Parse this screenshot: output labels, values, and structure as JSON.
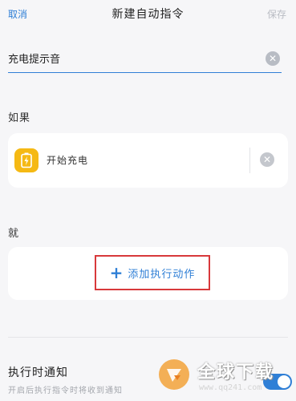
{
  "header": {
    "cancel_label": "取消",
    "title": "新建自动指令",
    "save_label": "保存"
  },
  "command_name": {
    "value": "充电提示音"
  },
  "effect_section": {
    "label": "如果",
    "item_text": "开始充电"
  },
  "action_section": {
    "label": "就",
    "add_action_label": "添加执行动作"
  },
  "notification": {
    "title": "执行时通知",
    "description": "开启后执行指令时将收到通知",
    "enabled": true
  },
  "watermark": {
    "title": "全球下载",
    "url": "www.qq241.com"
  },
  "colors": {
    "accent": "#2f7fd6",
    "highlight_border": "#d8393b",
    "charge_icon_bg": "#f5b914"
  }
}
